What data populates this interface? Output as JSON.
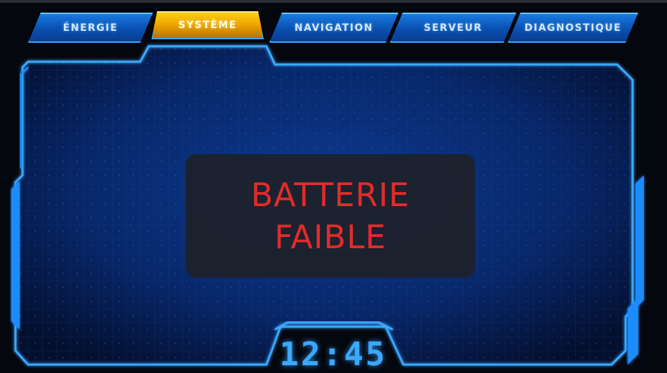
{
  "tabs": [
    {
      "label": "ÉNERGIE",
      "active": false
    },
    {
      "label": "SYSTÈME",
      "active": true
    },
    {
      "label": "NAVIGATION",
      "active": false
    },
    {
      "label": "SERVEUR",
      "active": false
    },
    {
      "label": "DIAGNOSTIQUE",
      "active": false
    }
  ],
  "alert": {
    "line1": "BATTERIE",
    "line2": "FAIBLE",
    "color": "#e22b2b"
  },
  "clock": {
    "time": "12:45"
  },
  "colors": {
    "accent_blue": "#3aa8ff",
    "active_tab": "#f0a800",
    "background": "#04070e"
  }
}
